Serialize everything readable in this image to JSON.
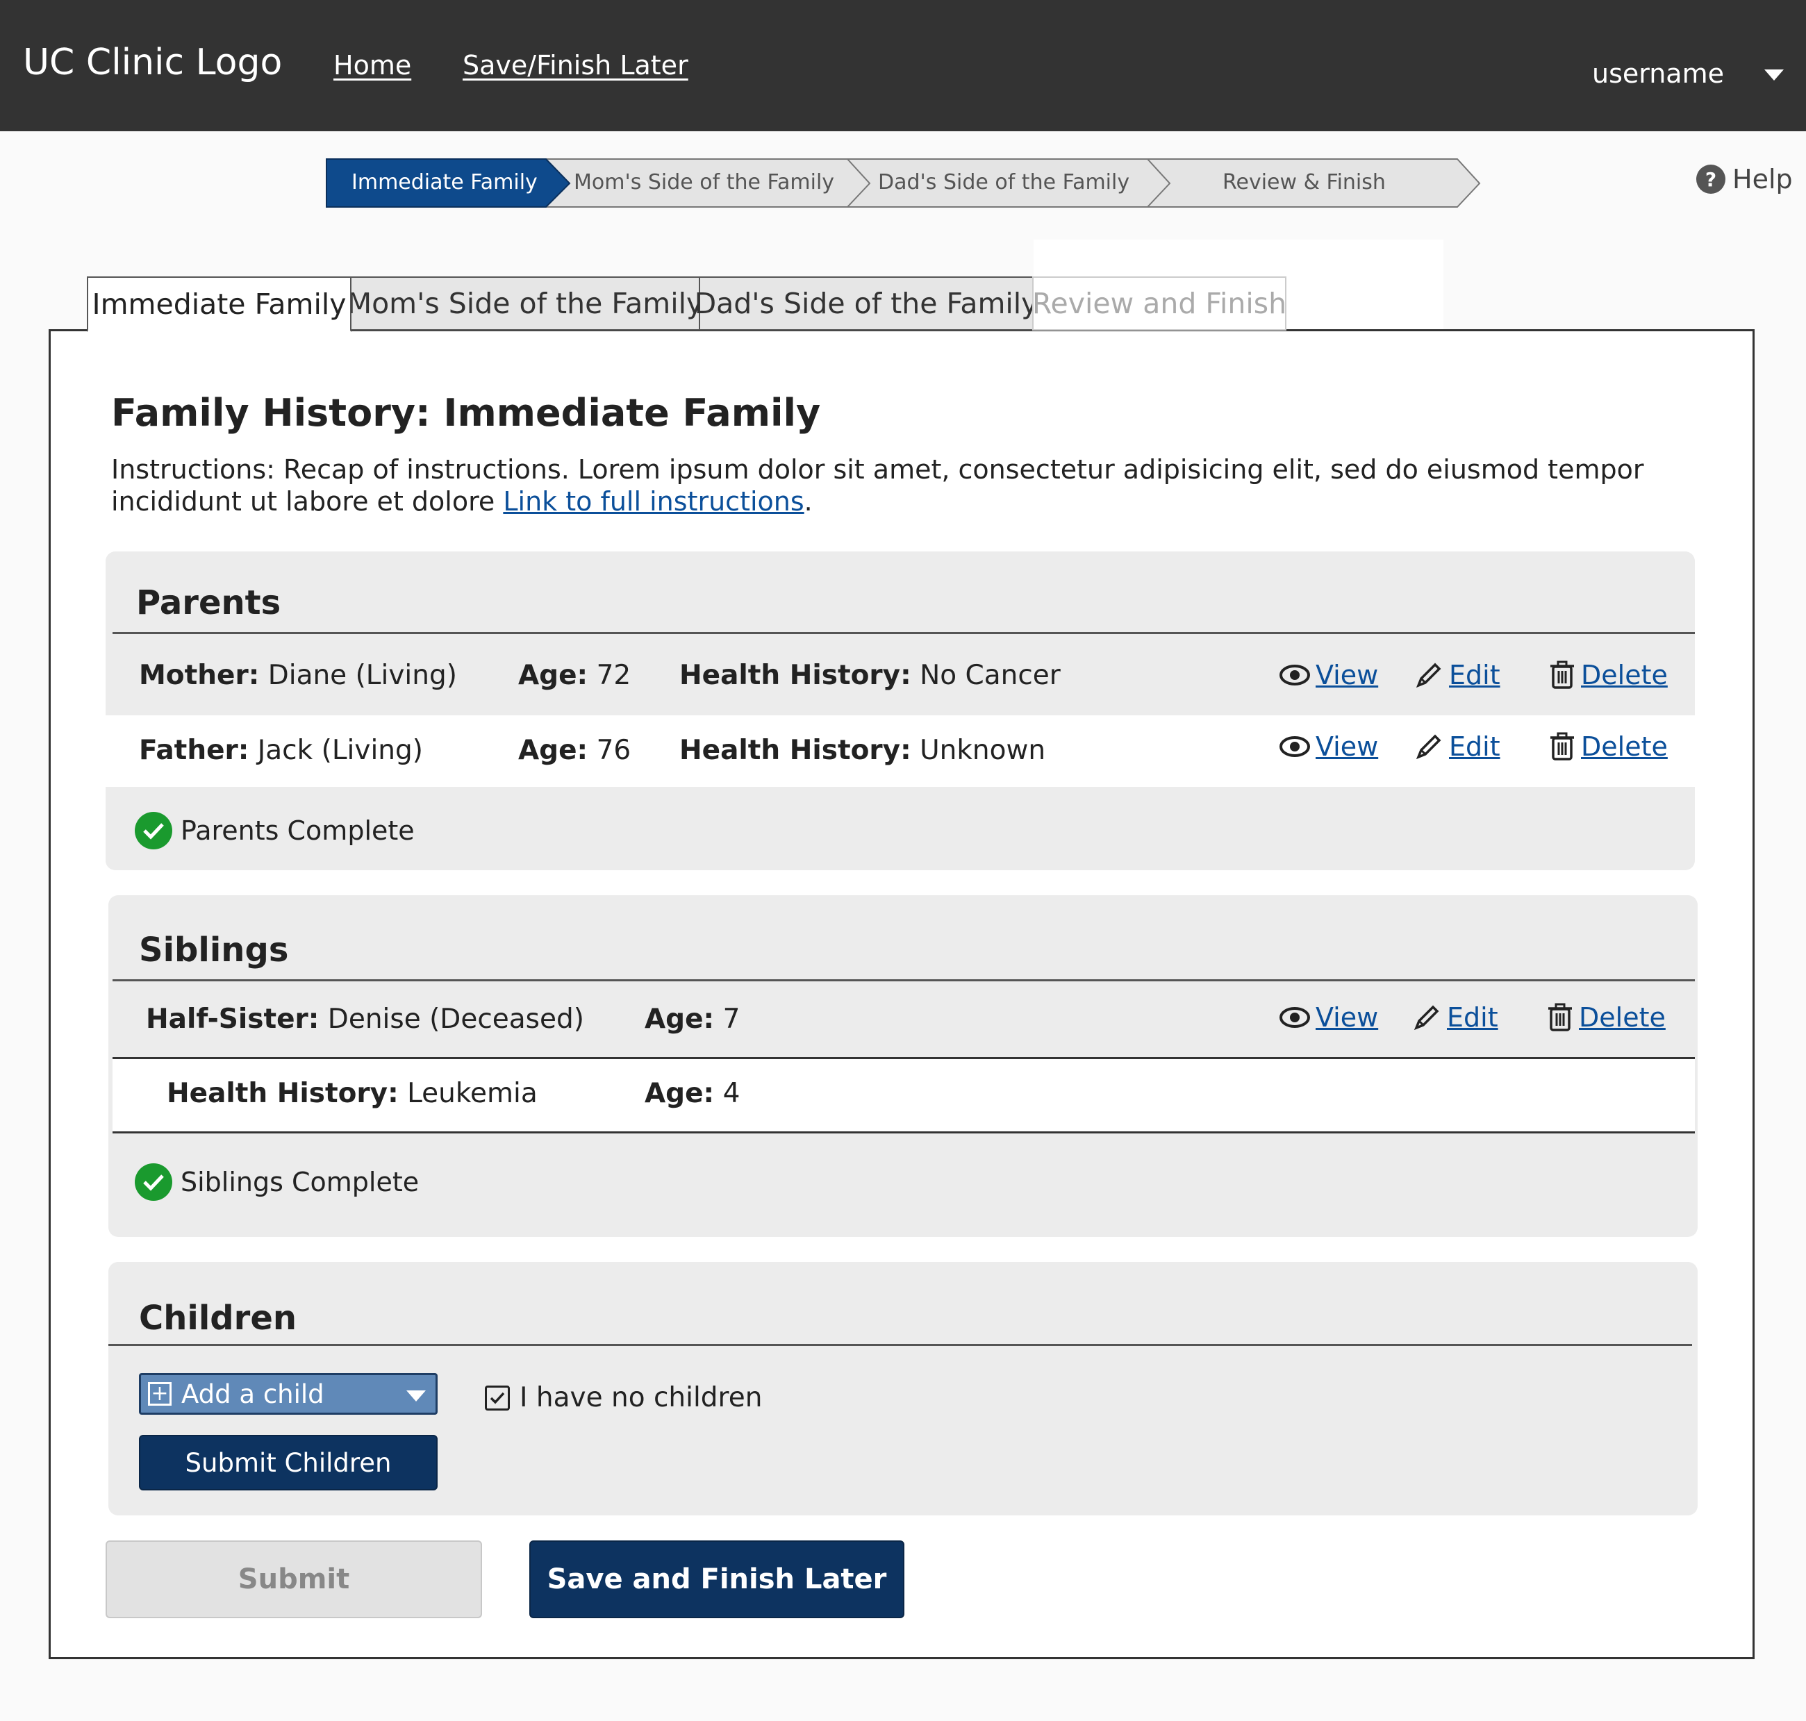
{
  "header": {
    "logo": "UC Clinic Logo",
    "nav": {
      "home": "Home",
      "save_finish_later": "Save/Finish Later"
    },
    "username": "username"
  },
  "stepper": {
    "steps": [
      {
        "label": "Immediate Family",
        "state": "active"
      },
      {
        "label": "Mom's Side of the Family",
        "state": "inactive"
      },
      {
        "label": "Dad's Side of the Family",
        "state": "inactive"
      },
      {
        "label": "Review & Finish",
        "state": "inactive"
      }
    ],
    "help": "Help"
  },
  "tabs": [
    {
      "label": "Immediate Family",
      "state": "active"
    },
    {
      "label": "Mom's Side of the Family",
      "state": "inactive"
    },
    {
      "label": "Dad's Side of the Family",
      "state": "inactive"
    },
    {
      "label": "Review and Finish",
      "state": "disabled"
    }
  ],
  "main": {
    "title": "Family History: Immediate Family",
    "instructions_prefix": "Instructions:  Recap of instructions. Lorem ipsum dolor sit amet, consectetur adipisicing elit, sed do eiusmod tempor incididunt ut labore et dolore ",
    "instructions_link": "Link to full instructions",
    "instructions_suffix": "."
  },
  "actions": {
    "view": "View",
    "edit": "Edit",
    "delete": "Delete"
  },
  "parents": {
    "title": "Parents",
    "rows": [
      {
        "relation": "Mother:",
        "name": "Diane (Living)",
        "age_label": "Age:",
        "age": "72",
        "hh_label": "Health History:",
        "hh": "No Cancer"
      },
      {
        "relation": "Father:",
        "name": "Jack (Living)",
        "age_label": "Age:",
        "age": "76",
        "hh_label": "Health History:",
        "hh": "Unknown"
      }
    ],
    "complete": "Parents Complete"
  },
  "siblings": {
    "title": "Siblings",
    "row": {
      "relation": "Half-Sister:",
      "name": "Denise (Deceased)",
      "age_label": "Age:",
      "age": "7"
    },
    "detail": {
      "hh_label": "Health History:",
      "hh": "Leukemia",
      "age_label": "Age:",
      "age": "4"
    },
    "complete": "Siblings Complete"
  },
  "children": {
    "title": "Children",
    "add_child": "Add a child",
    "no_children": "I have no children",
    "no_children_checked": true,
    "submit_children": "Submit Children"
  },
  "footer": {
    "submit": "Submit",
    "save_finish_later": "Save and Finish Later"
  },
  "colors": {
    "header_bg": "#333333",
    "primary": "#0d3360",
    "active_step": "#0e4a8c",
    "link": "#0b4f9a",
    "success": "#1a9a2e",
    "section_bg": "#ececec"
  }
}
